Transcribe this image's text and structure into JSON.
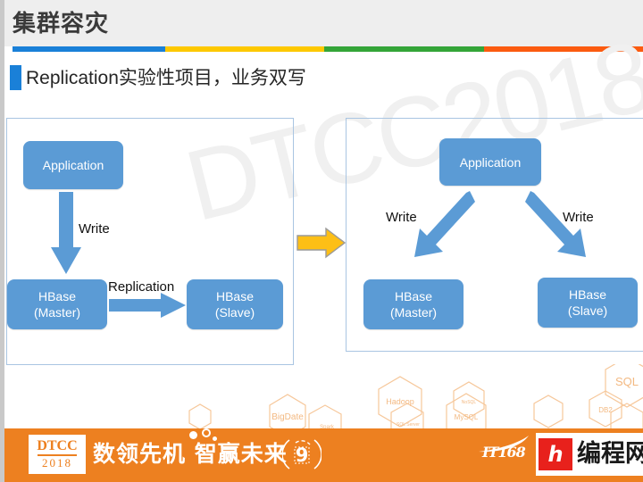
{
  "header": {
    "title": "集群容灾",
    "rule_colors": [
      "#1a80d8",
      "#fdc800",
      "#34a538",
      "#fb5b10"
    ]
  },
  "subtitle": {
    "latin": "Replication",
    "cjk": "实验性项目，业务双写"
  },
  "watermark": {
    "text": "DTCC2018",
    "color": "#f0f0f0"
  },
  "diagram": {
    "node_color": "#5b9bd5",
    "arrow_color": "#5b9bd5",
    "transition_arrow_color": "#fdbf16",
    "left_panel": {
      "nodes": {
        "application": "Application",
        "master_line1": "HBase",
        "master_line2": "(Master)",
        "slave_line1": "HBase",
        "slave_line2": "(Slave)"
      },
      "labels": {
        "write": "Write",
        "replication": "Replication"
      }
    },
    "right_panel": {
      "nodes": {
        "application": "Application",
        "master_line1": "HBase",
        "master_line2": "(Master)",
        "slave_line1": "HBase",
        "slave_line2": "(Slave)"
      },
      "labels": {
        "write_left": "Write",
        "write_right": "Write"
      }
    }
  },
  "hex_tags": [
    "Hadoop",
    "MySQL",
    "SQL",
    "BigDate",
    "DB2",
    "SQL Server",
    "Spark",
    "NoSQL"
  ],
  "footer": {
    "background": "#ed8020",
    "logo_top": "DTCC",
    "logo_bottom": "2018",
    "slogan": "数领先机 智赢未来",
    "circle_digit": "9",
    "partner_brand": "IT168",
    "site_mark": "h",
    "site_name": "编程网"
  }
}
